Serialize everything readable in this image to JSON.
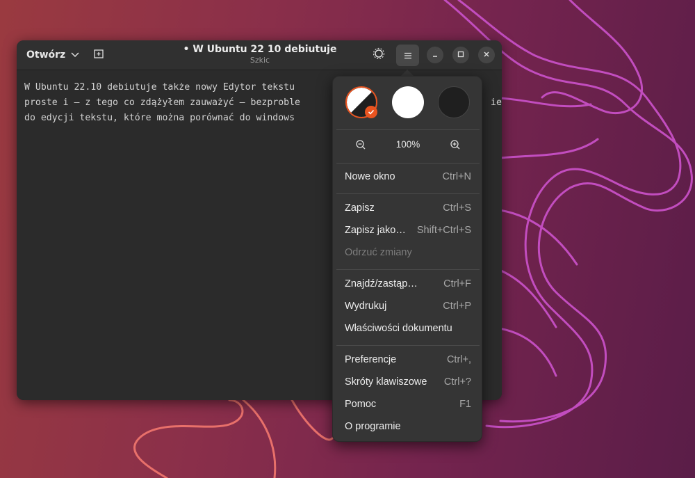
{
  "window": {
    "open_label": "Otwórz",
    "title": "• W Ubuntu 22 10 debiutuje",
    "subtitle": "Szkic"
  },
  "editor": {
    "lines": [
      "W Ubuntu 22.10 debiutuje także nowy Edytor tekstu",
      "proste i – z tego co zdążyłem zauważyć – bezproble",
      "do edycji tekstu, które można porównać do windows"
    ],
    "line_tail": "ie"
  },
  "menu": {
    "style_options": [
      {
        "name": "system",
        "selected": true
      },
      {
        "name": "light",
        "selected": false
      },
      {
        "name": "dark",
        "selected": false
      }
    ],
    "zoom": "100%",
    "items": [
      {
        "label": "Nowe okno",
        "shortcut": "Ctrl+N"
      },
      {
        "label": "Zapisz",
        "shortcut": "Ctrl+S"
      },
      {
        "label": "Zapisz jako…",
        "shortcut": "Shift+Ctrl+S"
      },
      {
        "label": "Odrzuć zmiany",
        "shortcut": ""
      },
      {
        "label": "Znajdź/zastąp…",
        "shortcut": "Ctrl+F"
      },
      {
        "label": "Wydrukuj",
        "shortcut": "Ctrl+P"
      },
      {
        "label": "Właściwości dokumentu",
        "shortcut": ""
      },
      {
        "label": "Preferencje",
        "shortcut": "Ctrl+,"
      },
      {
        "label": "Skróty klawiszowe",
        "shortcut": "Ctrl+?"
      },
      {
        "label": "Pomoc",
        "shortcut": "F1"
      },
      {
        "label": "O programie",
        "shortcut": ""
      }
    ]
  },
  "colors": {
    "accent": "#e95420",
    "wallpaper_line_pink": "#c24dbf",
    "wallpaper_line_orange": "#e8706a"
  },
  "icons": [
    "chevron-down-icon",
    "new-tab-icon",
    "theme-icon",
    "hamburger-menu-icon",
    "minimize-icon",
    "maximize-icon",
    "close-icon",
    "zoom-out-icon",
    "zoom-in-icon",
    "checkmark-icon"
  ]
}
